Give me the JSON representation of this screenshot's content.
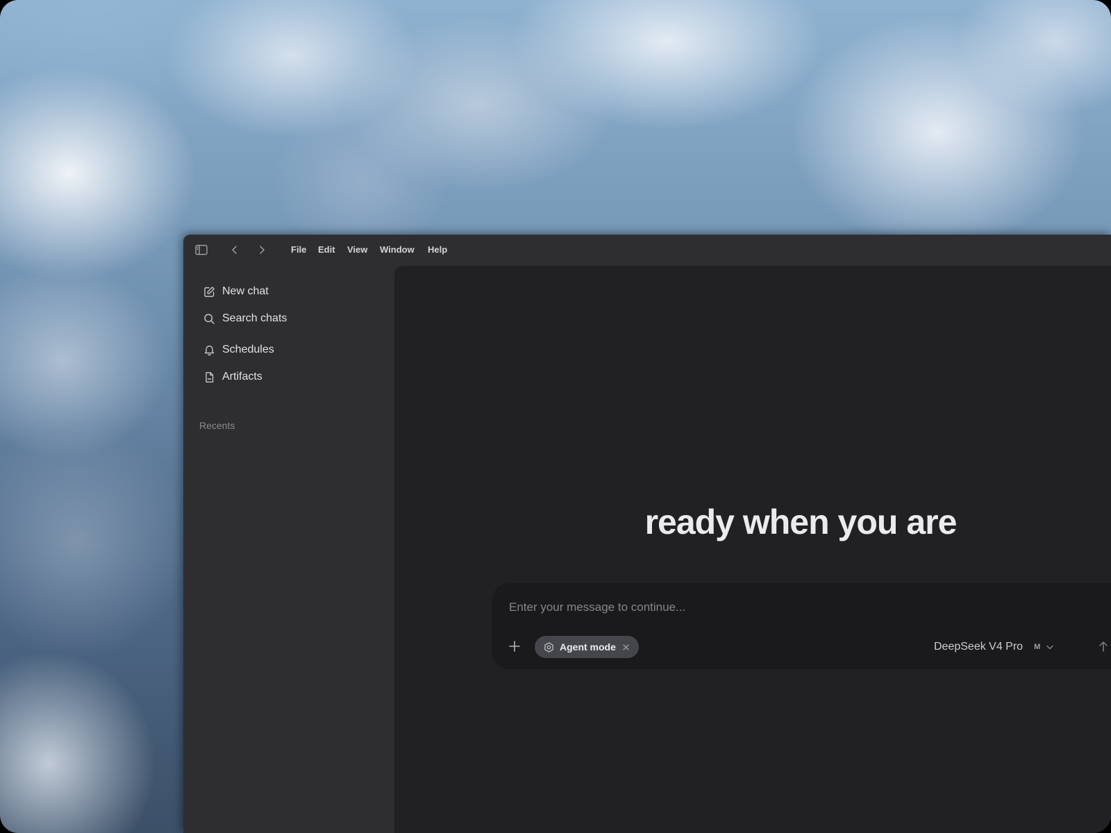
{
  "desktop": {
    "wallpaper": "cloud-sky-wallpaper"
  },
  "titlebar": {
    "menu": [
      "File",
      "Edit",
      "View",
      "Window",
      "Help"
    ],
    "icons": {
      "sidebar_toggle": "sidebar-toggle-icon",
      "back": "chevron-left-icon",
      "forward": "chevron-right-icon"
    }
  },
  "sidebar": {
    "items": [
      {
        "label": "New chat",
        "icon": "compose-icon"
      },
      {
        "label": "Search chats",
        "icon": "search-icon"
      },
      {
        "label": "Schedules",
        "icon": "bell-icon"
      },
      {
        "label": "Artifacts",
        "icon": "document-icon"
      }
    ],
    "recents_label": "Recents"
  },
  "main": {
    "greeting": "ready when you are",
    "composer": {
      "placeholder": "Enter your message to continue...",
      "value": "",
      "agent_mode_label": "Agent mode",
      "model_name": "DeepSeek V4 Pro",
      "model_badge": "M"
    }
  },
  "colors": {
    "window_bg": "#2e2e31",
    "main_bg": "#212124",
    "composer_bg": "#1a1a1c",
    "pill_bg": "#45464b",
    "text_primary": "#ebebee",
    "text_muted": "#88888d"
  }
}
